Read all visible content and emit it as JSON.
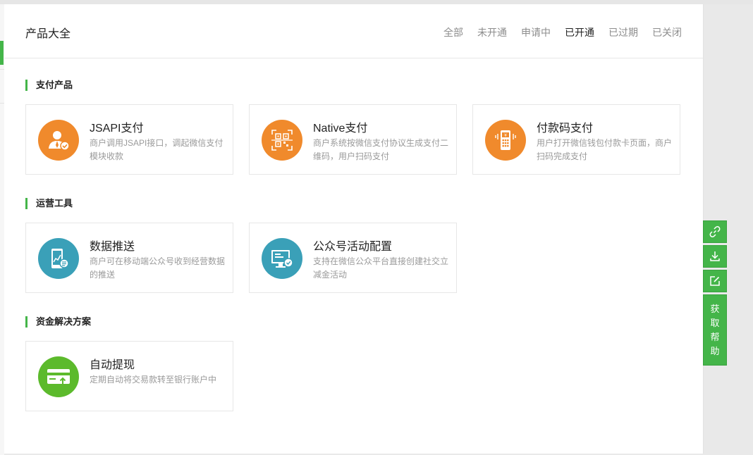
{
  "header": {
    "title": "产品大全",
    "filters": [
      "全部",
      "未开通",
      "申请中",
      "已开通",
      "已过期",
      "已关闭"
    ]
  },
  "sections": [
    {
      "title": "支付产品",
      "cards": [
        {
          "title": "JSAPI支付",
          "desc": "商户调用JSAPI接口，调起微信支付模块收款",
          "icon": "user-check-icon"
        },
        {
          "title": "Native支付",
          "desc": "商户系统按微信支付协议生成支付二维码，用户扫码支付",
          "icon": "qr-scan-icon"
        },
        {
          "title": "付款码支付",
          "desc": "用户打开微信钱包付款卡页面，商户扫码完成支付",
          "icon": "pos-terminal-icon"
        }
      ]
    },
    {
      "title": "运营工具",
      "cards": [
        {
          "title": "数据推送",
          "desc": "商户可在移动端公众号收到经营数据的推送",
          "icon": "phone-chart-icon"
        },
        {
          "title": "公众号活动配置",
          "desc": "支持在微信公众平台直接创建社交立减金活动",
          "icon": "monitor-settings-icon"
        }
      ]
    },
    {
      "title": "资金解决方案",
      "cards": [
        {
          "title": "自动提现",
          "desc": "定期自动将交易款转至银行账户中",
          "icon": "card-upload-icon"
        }
      ]
    }
  ],
  "side_tools": {
    "help_label": "获取帮助",
    "help_chars": [
      "获",
      "取",
      "帮",
      "助"
    ],
    "icons": [
      "link-icon",
      "download-icon",
      "edit-icon"
    ]
  },
  "colors": {
    "accent": "#44b549",
    "orange_icon": "#f08a2c",
    "teal_icon": "#3aa0b8",
    "green_icon": "#5cba2c"
  }
}
